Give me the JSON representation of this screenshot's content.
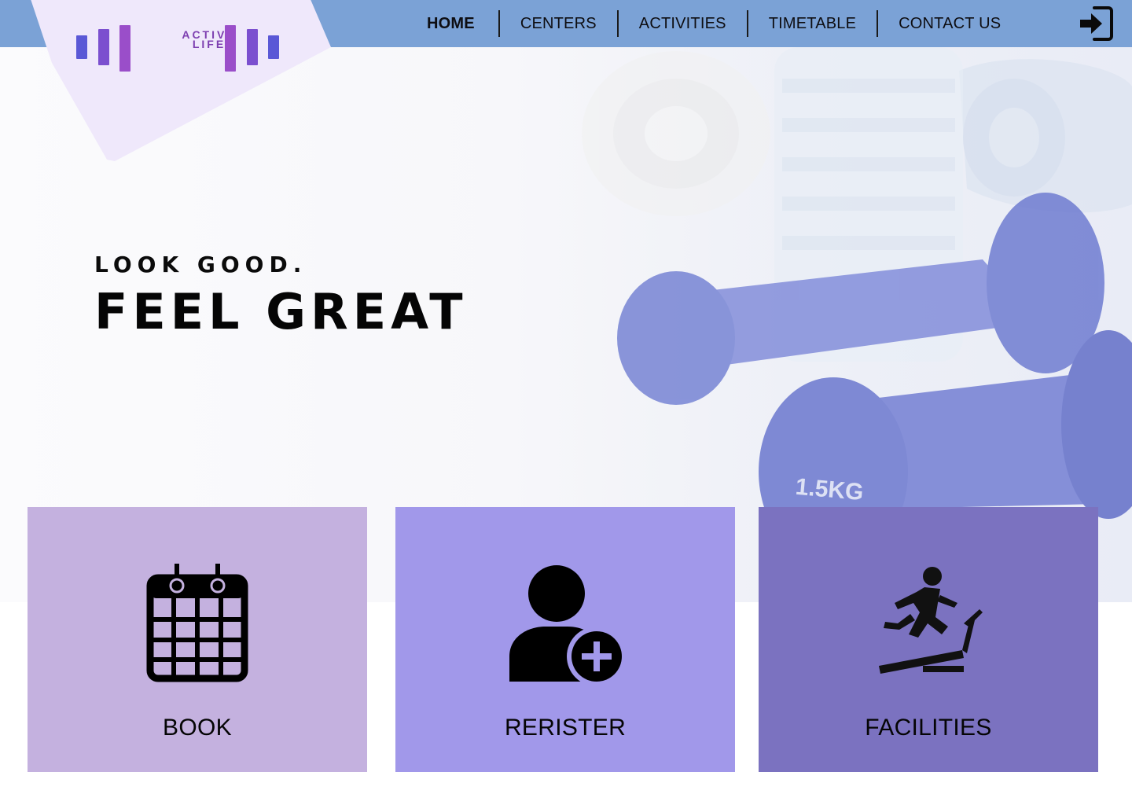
{
  "brand": {
    "name_line1": "ACTIVE",
    "name_line2": "LIFE",
    "colors": {
      "logo_primary": "#7d3fb0",
      "logo_secondary": "#5a58d6"
    }
  },
  "nav": {
    "items": [
      {
        "label": "HOME",
        "active": true
      },
      {
        "label": "CENTERS",
        "active": false
      },
      {
        "label": "ACTIVITIES",
        "active": false
      },
      {
        "label": "TIMETABLE",
        "active": false
      },
      {
        "label": "CONTACT US",
        "active": false
      }
    ],
    "login_icon": "sign-in-icon",
    "background_color": "#7ba2d6"
  },
  "hero": {
    "tagline_small": "LOOK GOOD.",
    "tagline_large": "FEEL GREAT",
    "photo_text": "1.5KG"
  },
  "tiles": [
    {
      "label": "BOOK",
      "icon": "calendar-icon",
      "color": "#c4b1df"
    },
    {
      "label": "RERISTER",
      "icon": "add-user-icon",
      "color": "#a198ea"
    },
    {
      "label": "FACILITIES",
      "icon": "treadmill-icon",
      "color": "#7b72c0"
    }
  ]
}
